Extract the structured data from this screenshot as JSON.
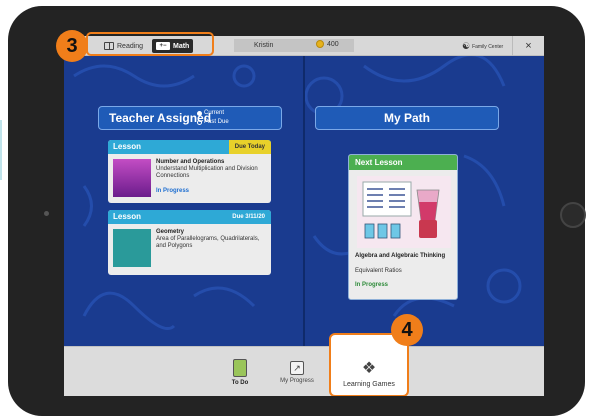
{
  "callouts": {
    "three": "3",
    "four": "4"
  },
  "topbar": {
    "reading_label": "Reading",
    "math_label": "Math",
    "math_icon": "+−",
    "user_name": "Kristin",
    "coins": "400",
    "family_center": "Family Center",
    "close": "×"
  },
  "left_panel": {
    "title": "Teacher Assigned",
    "radio_current": "Current",
    "radio_past_due": "Past Due",
    "cards": [
      {
        "type": "Lesson",
        "due": "Due Today",
        "title": "Number and Operations",
        "subtitle": "Understand Multiplication and Division Connections",
        "status": "In Progress"
      },
      {
        "type": "Lesson",
        "due": "Due 3/11/20",
        "title": "Geometry",
        "subtitle": "Area of Parallelograms, Quadrilaterals, and Polygons",
        "status": ""
      }
    ]
  },
  "right_panel": {
    "title": "My Path",
    "next_lesson": {
      "header": "Next Lesson",
      "title": "Algebra and Algebraic Thinking",
      "subtitle": "Equivalent Ratios",
      "status": "In Progress"
    }
  },
  "bottom_nav": {
    "todo": "To Do",
    "progress": "My Progress",
    "games": "Learning Games"
  },
  "colors": {
    "accent_orange": "#f07e1a",
    "background_blue": "#1a3b8f",
    "lesson_blue": "#2ea9d6",
    "next_green": "#4caf50",
    "due_yellow": "#e8d12a"
  }
}
